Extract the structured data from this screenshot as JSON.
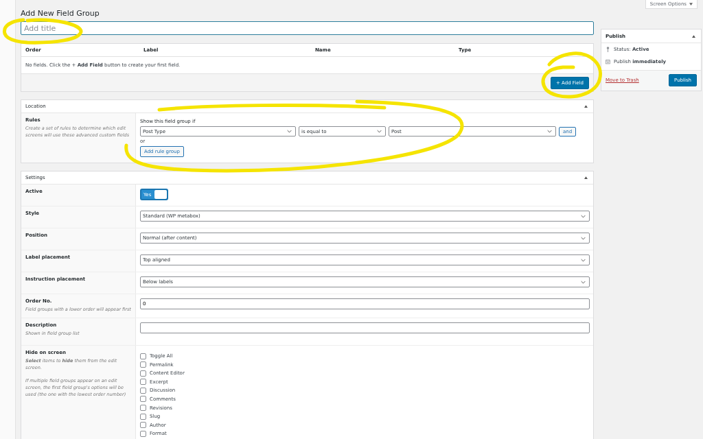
{
  "screen_options": "Screen Options",
  "page_title": "Add New Field Group",
  "title_field": {
    "placeholder": "Add title"
  },
  "fields_table": {
    "columns": [
      "Order",
      "Label",
      "Name",
      "Type"
    ],
    "empty_message": "No fields. Click the + **Add Field** button to create your first field.",
    "add_button": "+ Add Field"
  },
  "location": {
    "title": "Location",
    "rules_label": "Rules",
    "rules_hint": "Create a set of rules to determine which edit screens will use these advanced custom fields",
    "show_if": "Show this field group if",
    "rule": {
      "param": "Post Type",
      "operator": "is equal to",
      "value": "Post"
    },
    "and_button": "and",
    "or_label": "or",
    "add_group_button": "Add rule group"
  },
  "settings": {
    "title": "Settings",
    "rows": [
      {
        "kind": "toggle",
        "label": "Active",
        "on": true,
        "text": "Yes"
      },
      {
        "kind": "select",
        "label": "Style",
        "value": "Standard (WP metabox)"
      },
      {
        "kind": "select",
        "label": "Position",
        "value": "Normal (after content)"
      },
      {
        "kind": "select",
        "label": "Label placement",
        "value": "Top aligned"
      },
      {
        "kind": "select",
        "label": "Instruction placement",
        "value": "Below labels"
      },
      {
        "kind": "text",
        "label": "Order No.",
        "hint": "Field groups with a lower order will appear first",
        "value": "0"
      },
      {
        "kind": "text",
        "label": "Description",
        "hint": "Shown in field group list"
      },
      {
        "kind": "checklist",
        "label": "Hide on screen",
        "hints": [
          "**Select** items to **hide** them from the edit screen.",
          "If multiple field groups appear on an edit screen, the first field group's options will be used (the one with the lowest order number)"
        ],
        "items": [
          {
            "label": "Toggle All",
            "checked": false
          },
          {
            "label": "Permalink",
            "checked": false
          },
          {
            "label": "Content Editor",
            "checked": false
          },
          {
            "label": "Excerpt",
            "checked": false
          },
          {
            "label": "Discussion",
            "checked": false
          },
          {
            "label": "Comments",
            "checked": false
          },
          {
            "label": "Revisions",
            "checked": false
          },
          {
            "label": "Slug",
            "checked": false
          },
          {
            "label": "Author",
            "checked": false
          },
          {
            "label": "Format",
            "checked": false
          }
        ]
      }
    ]
  },
  "publish": {
    "title": "Publish",
    "status": "Status: **Active**",
    "schedule": "Publish **immediately**",
    "trash_link": "Move to Trash",
    "button": "Publish"
  }
}
